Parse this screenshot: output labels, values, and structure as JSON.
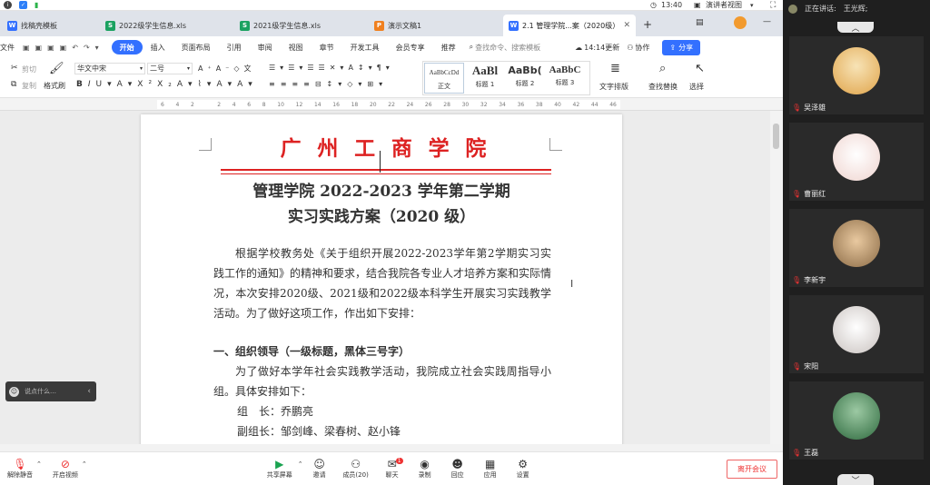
{
  "topbar": {
    "time": "13:40",
    "view_label": "演讲者视图"
  },
  "tabs": [
    {
      "label": "找稿壳模板",
      "icon": "W",
      "color": "#3370ff"
    },
    {
      "label": "2022级学生信息.xls",
      "icon": "S",
      "color": "#1ba261"
    },
    {
      "label": "2021级学生信息.xls",
      "icon": "S",
      "color": "#1ba261"
    },
    {
      "label": "演示文稿1",
      "icon": "P",
      "color": "#f0801f"
    },
    {
      "label": "2.1 管理学院...案（2020级）",
      "icon": "W",
      "color": "#3370ff"
    }
  ],
  "menu": {
    "file": "文件",
    "items": [
      "开始",
      "插入",
      "页面布局",
      "引用",
      "审阅",
      "视图",
      "章节",
      "开发工具",
      "会员专享",
      "推荐"
    ],
    "search_placeholder": "查找命令、搜索模板",
    "update": "14:14更新",
    "collab": "协作",
    "share": "分享"
  },
  "ribbon": {
    "cut": "剪切",
    "copy": "复制",
    "format_painter": "格式刷",
    "font": "华文中宋",
    "size": "二号",
    "styles": [
      {
        "preview": "AaBbCcDd",
        "label": "正文"
      },
      {
        "preview": "AaBl",
        "label": "标题 1"
      },
      {
        "preview": "AaBb(",
        "label": "标题 2"
      },
      {
        "preview": "AaBbC",
        "label": "标题 3"
      }
    ],
    "text_layout": "文字排版",
    "find_replace": "查找替换",
    "select": "选择"
  },
  "ruler": [
    "6",
    "4",
    "2",
    "",
    "2",
    "4",
    "6",
    "8",
    "10",
    "12",
    "14",
    "16",
    "18",
    "20",
    "22",
    "24",
    "26",
    "28",
    "30",
    "32",
    "34",
    "36",
    "38",
    "40",
    "42",
    "44",
    "46"
  ],
  "doc": {
    "header_title": "广 州 工 商 学 院",
    "title1": "管理学院 2022-2023 学年第二学期",
    "title2": "实习实践方案（2020 级）",
    "para1": "根据学校教务处《关于组织开展2022-2023学年第2学期实习实践工作的通知》的精神和要求，结合我院各专业人才培养方案和实际情况，本次安排2020级、2021级和2022级本科学生开展实习实践教学活动。为了做好这项工作，作出如下安排：",
    "heading1": "一、组织领导（一级标题，黑体三号字）",
    "para2": "为了做好本学年社会实践教学活动，我院成立社会实践周指导小组。具体安排如下：",
    "line1": "组　长：乔鹏亮",
    "line2": "副组长：邹剑峰、梁春树、赵小锋"
  },
  "chat": {
    "placeholder": "说点什么…"
  },
  "meeting": {
    "mute": "解除静音",
    "video": "开启视频",
    "share": "共享屏幕",
    "invite": "邀请",
    "members": "成员(20)",
    "chat": "聊天",
    "chat_badge": "1",
    "record": "录制",
    "reaction": "回应",
    "apps": "应用",
    "settings": "设置",
    "leave": "离开会议"
  },
  "panel": {
    "speaking_label": "正在讲话:",
    "speaker": "王光辉;"
  },
  "participants": [
    {
      "name": "吴泽雄",
      "color": "#e8c98e"
    },
    {
      "name": "曹丽红",
      "color": "#f1d9d6"
    },
    {
      "name": "李新宇",
      "color": "#b28a5c"
    },
    {
      "name": "宋阳",
      "color": "#d9d2cf"
    },
    {
      "name": "王磊",
      "color": "#4f8a5a"
    }
  ]
}
